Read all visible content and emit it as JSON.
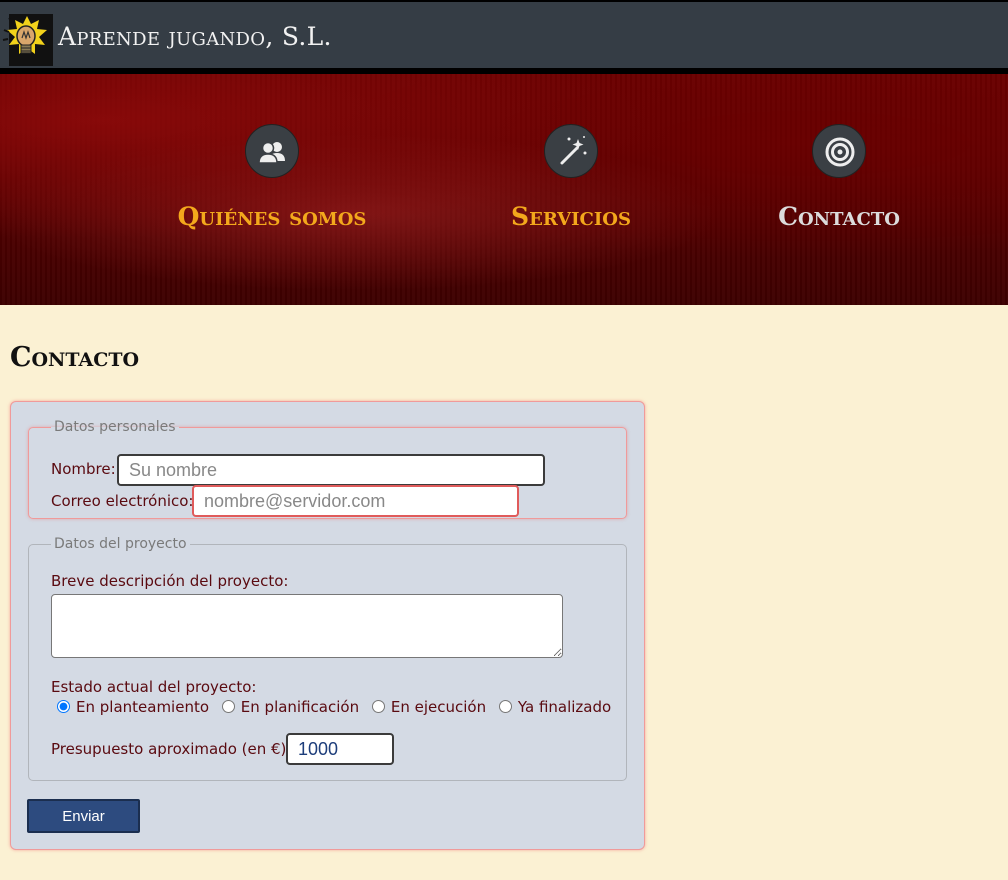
{
  "header": {
    "title": "Aprende jugando, S.L.",
    "logo_icon": "lightbulb-logo-icon"
  },
  "nav": {
    "items": [
      {
        "label": "Quiénes somos",
        "icon": "users-icon",
        "active": false
      },
      {
        "label": "Servicios",
        "icon": "magic-wand-icon",
        "active": false
      },
      {
        "label": "Contacto",
        "icon": "target-icon",
        "active": true
      }
    ]
  },
  "page": {
    "heading": "Contacto"
  },
  "form": {
    "personal": {
      "legend": "Datos personales",
      "name_label": "Nombre:",
      "name_placeholder": "Su nombre",
      "name_value": "",
      "email_label": "Correo electrónico:",
      "email_placeholder": "nombre@servidor.com",
      "email_value": ""
    },
    "project": {
      "legend": "Datos del proyecto",
      "description_label": "Breve descripción del proyecto:",
      "description_value": "",
      "status_label": "Estado actual del proyecto:",
      "status_options": [
        {
          "label": "En planteamiento",
          "checked": true
        },
        {
          "label": "En planificación",
          "checked": false
        },
        {
          "label": "En ejecución",
          "checked": false
        },
        {
          "label": "Ya finalizado",
          "checked": false
        }
      ],
      "budget_label": "Presupuesto aproximado (en €):",
      "budget_value": "1000"
    },
    "submit_label": "Enviar"
  },
  "colors": {
    "header_bg": "#353d45",
    "nav_label": "#f3a81c",
    "nav_label_active": "#dcdcdc",
    "page_bg": "#fbf1d3",
    "form_bg": "#d4dae4",
    "label_text": "#5a0a10",
    "button_bg": "#2d4b7f"
  }
}
